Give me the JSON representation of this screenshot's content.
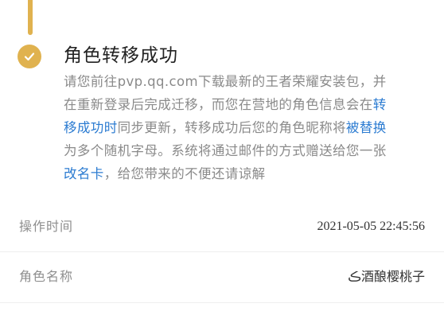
{
  "status": {
    "title": "角色转移成功",
    "desc_part1": "请您前往pvp.qq.com下载最新的王者荣耀安装包，并在重新登录后完成迁移，而您在营地的角色信息会在",
    "desc_hl1": "转移成功时",
    "desc_part2": "同步更新，转移成功后您的角色昵称将",
    "desc_hl2": "被替换",
    "desc_part3": "为多个随机字母。系统将通过邮件的方式赠送给您一张",
    "desc_hl3": "改名卡",
    "desc_part4": "，给您带来的不便还请谅解",
    "accent_color": "#e0b24f",
    "link_color": "#2b7bd1",
    "icon": "check-icon"
  },
  "details": {
    "op_time_label": "操作时间",
    "op_time_value": "2021-05-05 22:45:56",
    "role_name_label": "角色名称",
    "role_name_value": "ڪ酒酿樱桃子"
  }
}
